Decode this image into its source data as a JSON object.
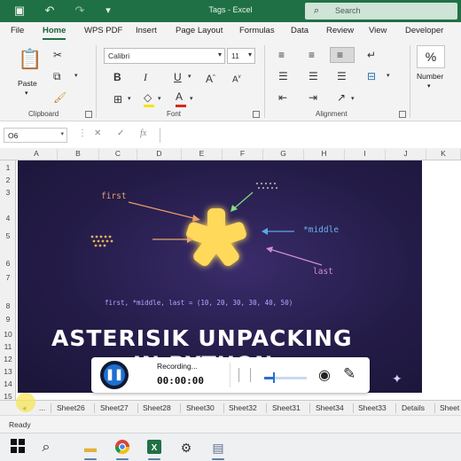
{
  "window": {
    "title": "Tags - Excel"
  },
  "search": {
    "placeholder": "Search"
  },
  "ribbon_tabs": [
    "File",
    "Home",
    "WPS PDF",
    "Insert",
    "Page Layout",
    "Formulas",
    "Data",
    "Review",
    "View",
    "Developer"
  ],
  "active_tab": "Home",
  "clipboard": {
    "paste_label": "Paste",
    "group_label": "Clipboard"
  },
  "font": {
    "name": "Calibri",
    "size": "11",
    "group_label": "Font",
    "font_color": "#d9261c",
    "fill_color": "#f7e21b"
  },
  "alignment": {
    "group_label": "Alignment"
  },
  "number": {
    "symbol": "%",
    "label": "Number"
  },
  "namebox": {
    "value": "O6"
  },
  "formula": {
    "fx_label": "fx"
  },
  "columns": [
    "A",
    "B",
    "C",
    "D",
    "E",
    "F",
    "G",
    "H",
    "I",
    "J",
    "K"
  ],
  "rows": [
    "1",
    "2",
    "3",
    "4",
    "5",
    "6",
    "7",
    "8",
    "9",
    "10",
    "11",
    "12",
    "13",
    "14",
    "15"
  ],
  "image": {
    "label_first": "first",
    "label_middle": "*middle",
    "label_last": "last",
    "code_line": "first, *middle, last = (10, 20, 30, 30, 40, 50)",
    "headline_1": "ASTERISIK UNPACKING",
    "headline_2": "IN PYTHON"
  },
  "recording": {
    "status": "Recording...",
    "timer": "00:00:00",
    "volume": 0.2
  },
  "sheet_tabs": [
    "Sheet26",
    "Sheet27",
    "Sheet28",
    "Sheet30",
    "Sheet32",
    "Sheet31",
    "Sheet34",
    "Sheet33",
    "Details",
    "Sheet"
  ],
  "sheet_nav": {
    "prev": "◂",
    "more": "..."
  },
  "status": {
    "text": "Ready"
  },
  "colors": {
    "excel_green": "#1f7145",
    "image_bg": "#241c48",
    "asterisk": "#ffd95a"
  }
}
